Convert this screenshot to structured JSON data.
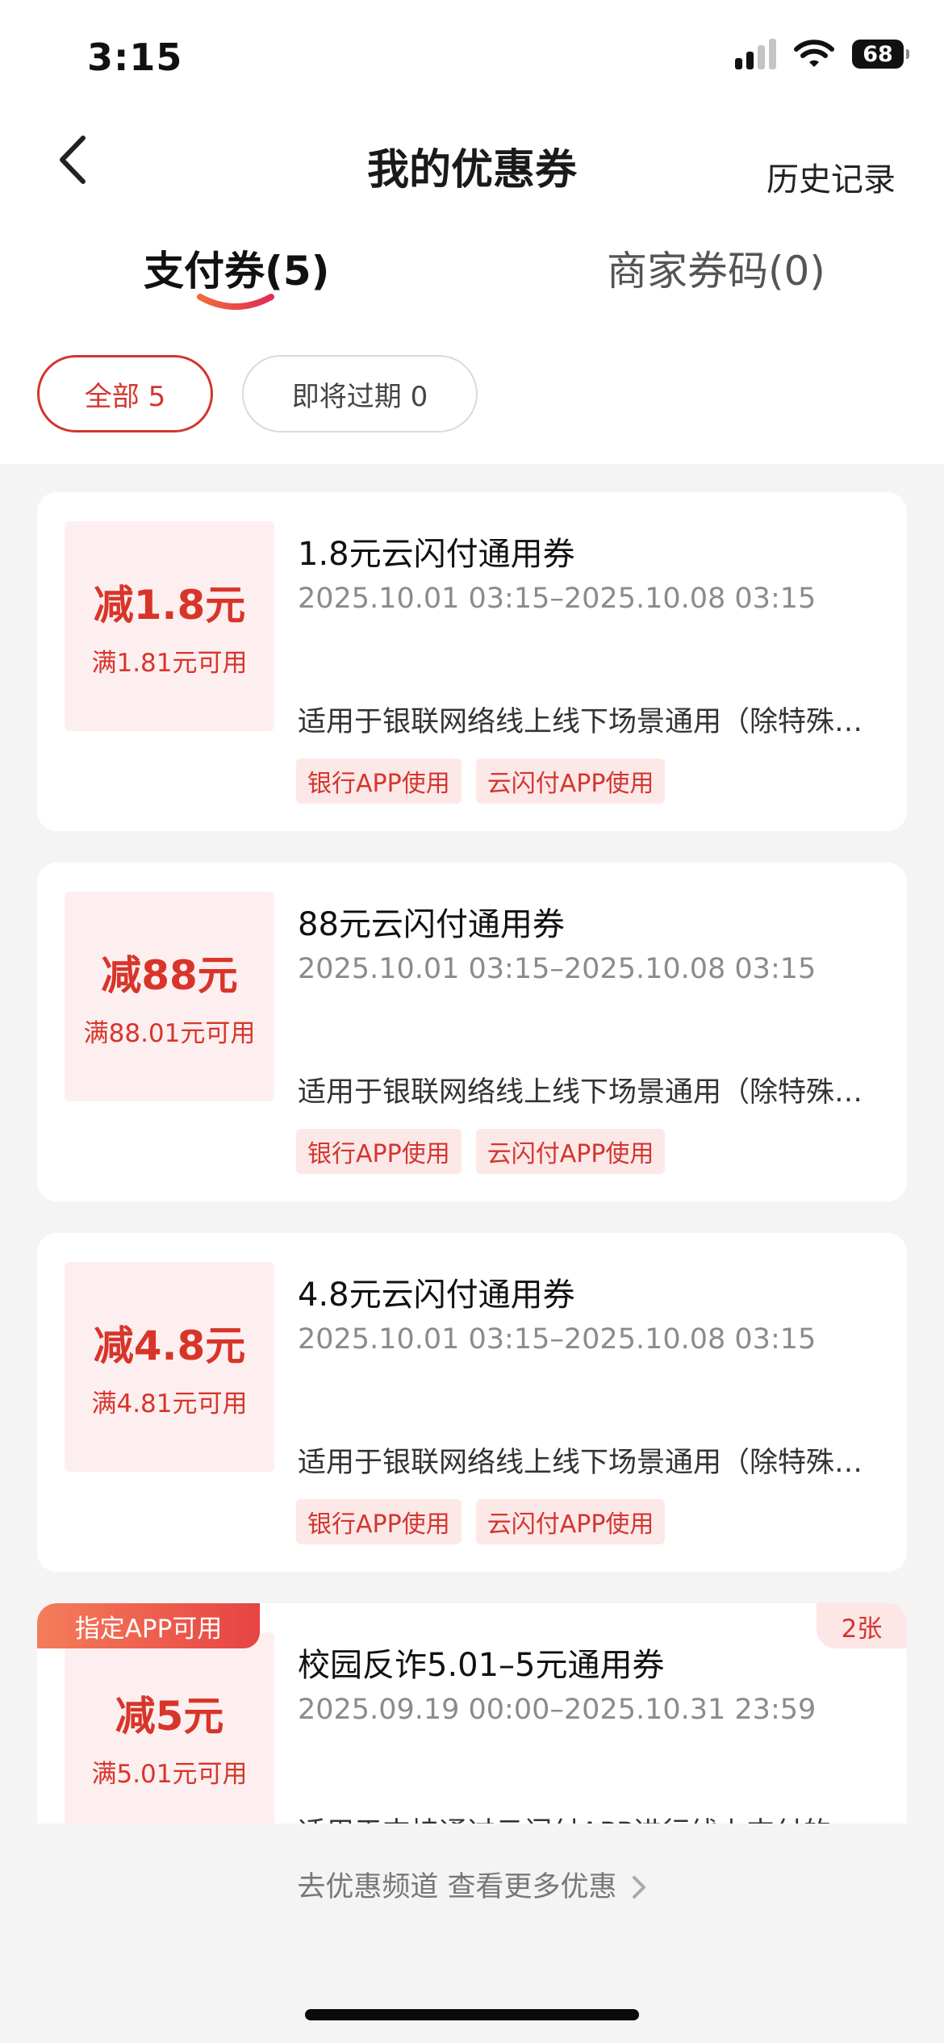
{
  "status_bar": {
    "time": "3:15",
    "battery": "68"
  },
  "header": {
    "title": "我的优惠券",
    "history_label": "历史记录"
  },
  "tabs": [
    {
      "label": "支付券(5)",
      "active": true
    },
    {
      "label": "商家券码(0)",
      "active": false
    }
  ],
  "filters": [
    {
      "label": "全部 5",
      "active": true
    },
    {
      "label": "即将过期 0",
      "active": false
    }
  ],
  "coupons": [
    {
      "amount": "减1.8元",
      "condition": "满1.81元可用",
      "title": "1.8元云闪付通用券",
      "period": "2025.10.01 03:15–2025.10.08 03:15",
      "description": "适用于银联网络线上线下场景通用（除特殊…",
      "tags": [
        "银行APP使用",
        "云闪付APP使用"
      ]
    },
    {
      "amount": "减88元",
      "condition": "满88.01元可用",
      "title": "88元云闪付通用券",
      "period": "2025.10.01 03:15–2025.10.08 03:15",
      "description": "适用于银联网络线上线下场景通用（除特殊…",
      "tags": [
        "银行APP使用",
        "云闪付APP使用"
      ]
    },
    {
      "amount": "减4.8元",
      "condition": "满4.81元可用",
      "title": "4.8元云闪付通用券",
      "period": "2025.10.01 03:15–2025.10.08 03:15",
      "description": "适用于银联网络线上线下场景通用（除特殊…",
      "tags": [
        "银行APP使用",
        "云闪付APP使用"
      ]
    },
    {
      "ribbon": "指定APP可用",
      "count": "2张",
      "amount": "减5元",
      "condition": "满5.01元可用",
      "title": "校园反诈5.01–5元通用券",
      "period": "2025.09.19 00:00–2025.10.31 23:59",
      "description": "适用于支持通过云闪付APP进行线上支付的…"
    }
  ],
  "footer": {
    "more_link": "去优惠频道 查看更多优惠"
  },
  "colors": {
    "accent": "#d2362e",
    "tag_bg": "#fde8e8",
    "stub_bg": "#fdeff0"
  }
}
